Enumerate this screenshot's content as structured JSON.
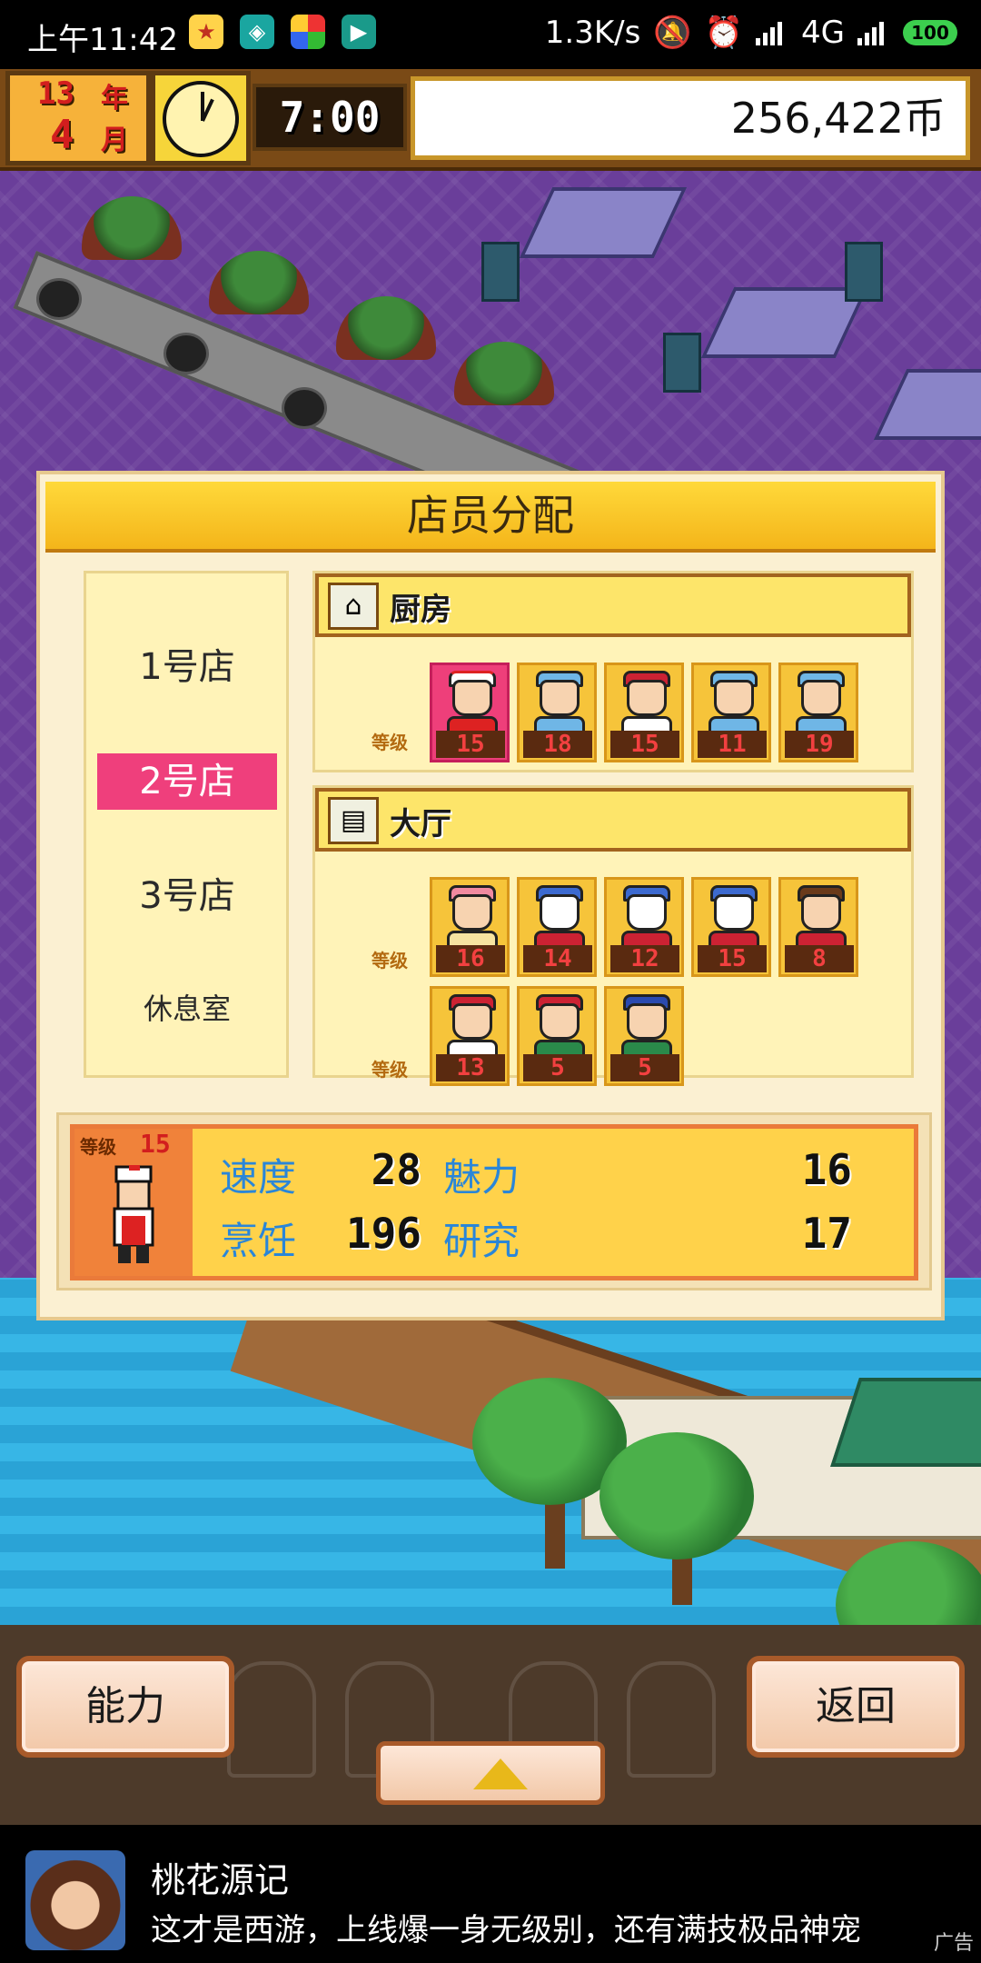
{
  "status_bar": {
    "time": "上午11:42",
    "net_speed": "1.3K/s",
    "network": "4G",
    "battery": "100"
  },
  "hud": {
    "year": "13",
    "year_unit": "年",
    "month": "4",
    "month_unit": "月",
    "game_time": "7:00",
    "money": "256,422币"
  },
  "dialog": {
    "title": "店员分配",
    "stores": [
      "1号店",
      "2号店",
      "3号店",
      "休息室"
    ],
    "selected_store": "2号店",
    "level_label": "等级",
    "kitchen": {
      "label": "厨房",
      "staff_levels": [
        "15",
        "18",
        "15",
        "11",
        "19"
      ]
    },
    "hall": {
      "label": "大厅",
      "staff_levels_row1": [
        "16",
        "14",
        "12",
        "15",
        "8"
      ],
      "staff_levels_row2": [
        "13",
        "5",
        "5"
      ]
    },
    "detail": {
      "level_label": "等级",
      "level": "15",
      "stats": [
        {
          "label": "速度",
          "value": "28"
        },
        {
          "label": "魅力",
          "value": "16"
        },
        {
          "label": "烹饪",
          "value": "196"
        },
        {
          "label": "研究",
          "value": "17"
        }
      ]
    }
  },
  "bottom_bar": {
    "ability_label": "能力",
    "back_label": "返回",
    "expand_icon": "triangle-up-icon"
  },
  "ad": {
    "title": "桃花源记",
    "description": "这才是西游，上线爆一身无级别，还有满技极品神宠",
    "tag": "广告"
  },
  "colors": {
    "selected_pink": "#ef3f7c",
    "stat_blue": "#2a86d8",
    "slot_yellow": "#f6c43a",
    "title_gold": "#ffd93a"
  }
}
